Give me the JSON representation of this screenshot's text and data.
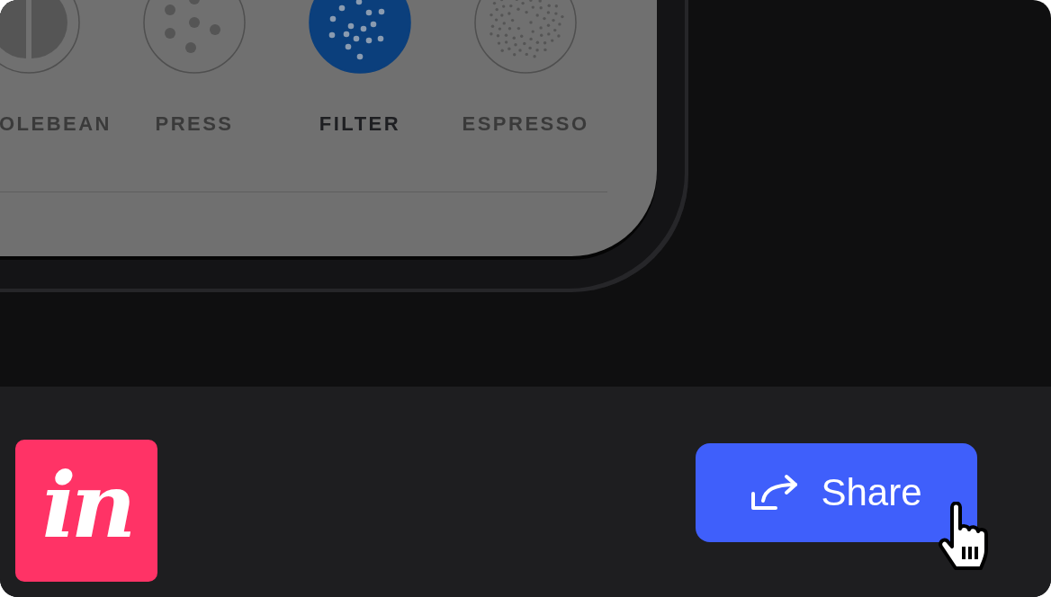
{
  "grind_options": [
    {
      "label": "OLEBEAN",
      "kind": "whole",
      "selected": false
    },
    {
      "label": "PRESS",
      "kind": "press",
      "selected": false
    },
    {
      "label": "FILTER",
      "kind": "filter",
      "selected": true
    },
    {
      "label": "ESPRESSO",
      "kind": "espresso",
      "selected": false
    }
  ],
  "logo": {
    "text": "in"
  },
  "share_button": {
    "label": "Share"
  }
}
